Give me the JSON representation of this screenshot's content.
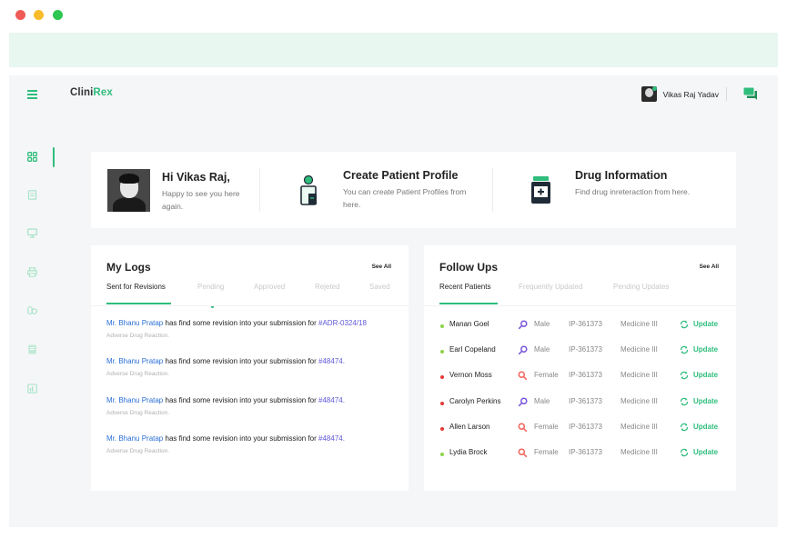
{
  "colors": {
    "accent": "#2fbd7c",
    "link": "#2b6fd6",
    "ref": "#5f57d6",
    "active_status": "#8dd34a",
    "critical_status": "#e53935",
    "male": "#7b57d9",
    "female": "#f0645c"
  },
  "header": {
    "brand_part1": "Clini",
    "brand_part2": "Rex",
    "user_name": "Vikas Raj Yadav"
  },
  "sidebar": {
    "items": [
      "dashboard-icon",
      "document-icon",
      "monitor-icon",
      "printer-icon",
      "pills-icon",
      "book-icon",
      "report-icon"
    ]
  },
  "welcome": {
    "greeting": "Hi Vikas Raj,",
    "greeting_sub": "Happy to see you here again.",
    "create_title": "Create Patient Profile",
    "create_desc": "You can create Patient Profiles from here.",
    "drug_title": "Drug Information",
    "drug_desc": "Find drug inreteraction from here."
  },
  "logs": {
    "title": "My Logs",
    "see_all": "See All",
    "tabs": [
      "Sent for Revisions",
      "Pending",
      "Approved",
      "Rejeted",
      "Saved"
    ],
    "items": [
      {
        "who": "Mr. Bhanu Pratap",
        "text": " has find some revision into your submission for ",
        "ref": "#ADR-0324/18",
        "sub": "Adverse Drug Reaction."
      },
      {
        "who": "Mr. Bhanu Pratap",
        "text": " has find some revision into your submission for ",
        "ref": "#48474.",
        "sub": "Adverse Drug Reaction."
      },
      {
        "who": "Mr. Bhanu Pratap",
        "text": " has find some revision into your submission for ",
        "ref": "#48474.",
        "sub": "Adverse Drug Reaction."
      },
      {
        "who": "Mr. Bhanu Pratap",
        "text": " has find some revision into your submission for ",
        "ref": "#48474.",
        "sub": "Adverse Drug Reaction."
      }
    ]
  },
  "followups": {
    "title": "Follow Ups",
    "see_all": "See All",
    "tabs": [
      "Recent Patients",
      "Frequently Updated",
      "Pending Updates"
    ],
    "patients": [
      {
        "name": "Manan Goel",
        "status": "green",
        "gender": "Male",
        "id": "IP-361373",
        "dept": "Medicine III",
        "action": "Update"
      },
      {
        "name": "Earl Copeland",
        "status": "green",
        "gender": "Male",
        "id": "IP-361373",
        "dept": "Medicine III",
        "action": "Update"
      },
      {
        "name": "Vernon Moss",
        "status": "red",
        "gender": "Female",
        "id": "IP-361373",
        "dept": "Medicine III",
        "action": "Update"
      },
      {
        "name": "Carolyn Perkins",
        "status": "red",
        "gender": "Male",
        "id": "IP-361373",
        "dept": "Medicine III",
        "action": "Update"
      },
      {
        "name": "Allen Larson",
        "status": "red",
        "gender": "Female",
        "id": "IP-361373",
        "dept": "Medicine III",
        "action": "Update"
      },
      {
        "name": "Lydia Brock",
        "status": "green",
        "gender": "Female",
        "id": "IP-361373",
        "dept": "Medicine III",
        "action": "Update"
      }
    ]
  }
}
